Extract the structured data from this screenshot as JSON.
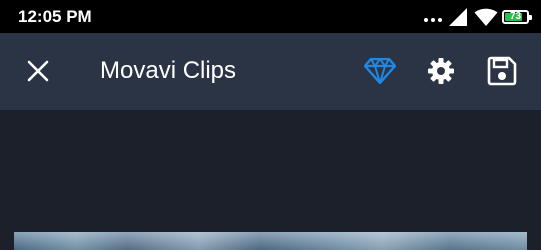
{
  "status_bar": {
    "time": "12:05 PM",
    "battery_level": "73",
    "icons": [
      "dots-icon",
      "cellular-signal-icon",
      "wifi-icon",
      "battery-icon"
    ]
  },
  "app_bar": {
    "title": "Movavi Clips",
    "close_icon": "close-icon",
    "premium_icon": "diamond-icon",
    "settings_icon": "gear-icon",
    "save_icon": "floppy-disk-icon"
  },
  "colors": {
    "status_bar_bg": "#000000",
    "app_bar_bg": "#2b3444",
    "page_bg": "#1b202a",
    "accent_premium": "#1e88e5",
    "battery_fill": "#2bbf4f",
    "icon_color": "#ffffff"
  }
}
